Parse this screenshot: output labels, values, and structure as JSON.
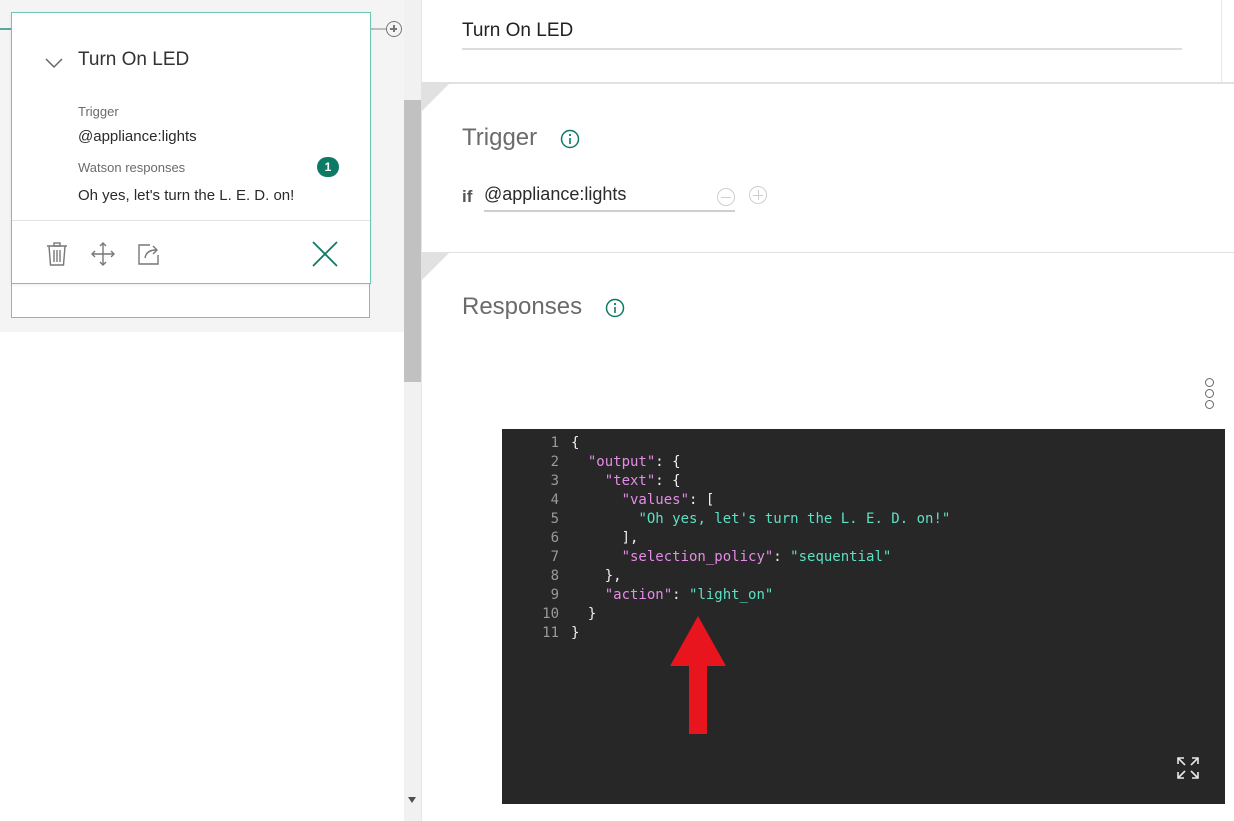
{
  "node_card": {
    "title": "Turn On LED",
    "trigger_label": "Trigger",
    "trigger_value": "@appliance:lights",
    "responses_label": "Watson responses",
    "responses_count": "1",
    "response_text": "Oh yes, let's turn the L. E. D. on!"
  },
  "node_card_icons": [
    "chevron-down-icon",
    "trash-icon",
    "move-icon",
    "jump-to-icon",
    "close-icon"
  ],
  "editor_panel": {
    "node_name_value": "Turn On LED",
    "trigger_section": {
      "title": "Trigger",
      "if_label": "if",
      "condition_value": "@appliance:lights"
    },
    "responses_section": {
      "title": "Responses"
    }
  },
  "code_editor": {
    "line_numbers": [
      "1",
      "2",
      "3",
      "4",
      "5",
      "6",
      "7",
      "8",
      "9",
      "10",
      "11"
    ],
    "lines": [
      [
        [
          "p",
          "{"
        ]
      ],
      [
        [
          "p",
          "  "
        ],
        [
          "k",
          "\"output\""
        ],
        [
          "p",
          ": {"
        ]
      ],
      [
        [
          "p",
          "    "
        ],
        [
          "k",
          "\"text\""
        ],
        [
          "p",
          ": {"
        ]
      ],
      [
        [
          "p",
          "      "
        ],
        [
          "k",
          "\"values\""
        ],
        [
          "p",
          ": ["
        ]
      ],
      [
        [
          "p",
          "        "
        ],
        [
          "s",
          "\"Oh yes, let's turn the L. E. D. on!\""
        ]
      ],
      [
        [
          "p",
          "      ],"
        ]
      ],
      [
        [
          "p",
          "      "
        ],
        [
          "k",
          "\"selection_policy\""
        ],
        [
          "p",
          ": "
        ],
        [
          "s",
          "\"sequential\""
        ]
      ],
      [
        [
          "p",
          "    },"
        ]
      ],
      [
        [
          "p",
          "    "
        ],
        [
          "k",
          "\"action\""
        ],
        [
          "p",
          ": "
        ],
        [
          "s",
          "\"light_on\""
        ]
      ],
      [
        [
          "p",
          "  }"
        ]
      ],
      [
        [
          "p",
          "}"
        ]
      ]
    ]
  },
  "colors": {
    "accent_teal": "#0e7a65",
    "card_border": "#6cc7b3",
    "editor_bg": "#272727",
    "json_key": "#e58be8",
    "json_string": "#5ce0c4",
    "annotation_arrow": "#e8141e"
  }
}
